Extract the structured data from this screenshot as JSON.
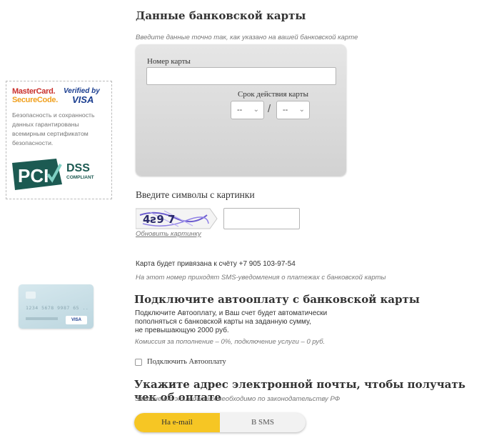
{
  "card_section": {
    "title": "Данные банковской карты",
    "hint": "Введите данные точно так, как указано на вашей банковской карте",
    "card_number_label": "Номер карты",
    "card_number_value": "",
    "expiry_label": "Срок действия карты",
    "expiry_month": "--",
    "expiry_year": "--",
    "separator": "/"
  },
  "security_box": {
    "mastercard_line1": "MasterCard.",
    "mastercard_line2": "SecureCode.",
    "verified_line1": "Verified by",
    "verified_line2": "VISA",
    "text": "Безопасность и сохранность данных гарантированы всемирным сертификатом безопасности.",
    "dss_line1": "DSS",
    "dss_line2": "COMPLIANT"
  },
  "captcha": {
    "title": "Введите символы с картинки",
    "image_text": "4ƨ9 7",
    "refresh_link": "Обновить картинку",
    "input_value": ""
  },
  "account": {
    "bind_text": "Карта будет привязана к счёту +7 905 103-97-54",
    "sms_hint": "На этот номер приходят SMS-уведомления о платежах с банковской карты"
  },
  "autopay": {
    "title": "Подключите автооплату с банковской карты",
    "desc_line1": "Подключите Автооплату, и Ваш счет будет автоматически",
    "desc_line2": "пополняться с банковской карты на заданную сумму,",
    "desc_line3": "не превышающую 2000 руб.",
    "commission": "Комиссия за пополнение – 0%, подключение услуги – 0 руб.",
    "checkbox_label": "Подключить Автооплату",
    "checkbox_checked": false
  },
  "mini_card": {
    "number": "1234  5678  9987  65 ..",
    "brand": "VISA"
  },
  "email_section": {
    "title": "Укажите адрес электронной почты, чтобы получать чек об оплате",
    "hint": "Заполнение этих данных необходимо по законодательству РФ",
    "tab_email": "На e-mail",
    "tab_sms": "В SMS",
    "active_tab": "На e-mail"
  },
  "colors": {
    "accent_yellow": "#f6c624",
    "card_panel": "#d9d9d9",
    "pci_green": "#1c5a52"
  }
}
